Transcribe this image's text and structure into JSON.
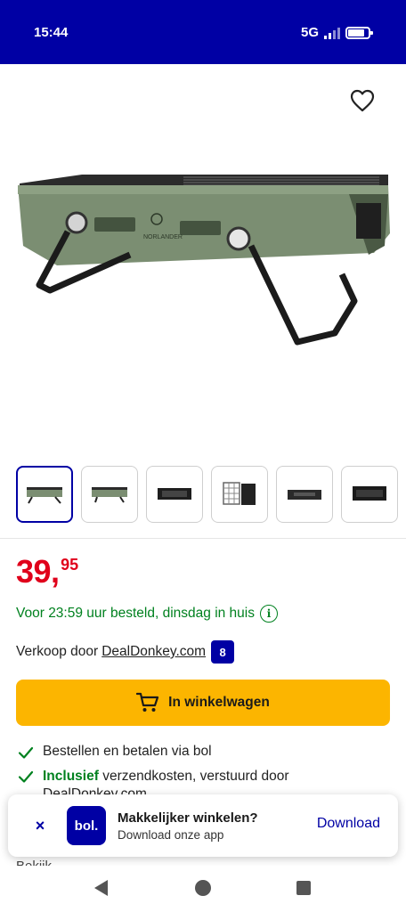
{
  "status_bar": {
    "time": "15:44",
    "network": "5G"
  },
  "product": {
    "image_alt": "NORLANDER",
    "thumbnails": [
      "thumb-1",
      "thumb-2",
      "thumb-3",
      "thumb-4",
      "thumb-5",
      "thumb-6"
    ],
    "active_thumbnail_index": 0
  },
  "price": {
    "integer": "39",
    "comma": ",",
    "decimals": "95"
  },
  "delivery": {
    "text": "Voor 23:59 uur besteld, dinsdag in huis",
    "info_icon": "i"
  },
  "seller": {
    "prefix": "Verkoop door",
    "name": "DealDonkey.com",
    "score": "8"
  },
  "cart": {
    "label": "In winkelwagen"
  },
  "usps": [
    {
      "bold": "",
      "text": "Bestellen en betalen via bol"
    },
    {
      "bold": "Inclusief",
      "text": " verzendkosten, verstuurd door DealDonkey.com"
    }
  ],
  "partial_text": "Bekijk ...",
  "app_banner": {
    "close_symbol": "×",
    "logo_text": "bol.",
    "title": "Makkelijker winkelen?",
    "subtitle": "Download onze app",
    "cta": "Download"
  },
  "colors": {
    "brand": "#0000a4",
    "price": "#e0001b",
    "success": "#00811f",
    "cta": "#fcb500"
  }
}
